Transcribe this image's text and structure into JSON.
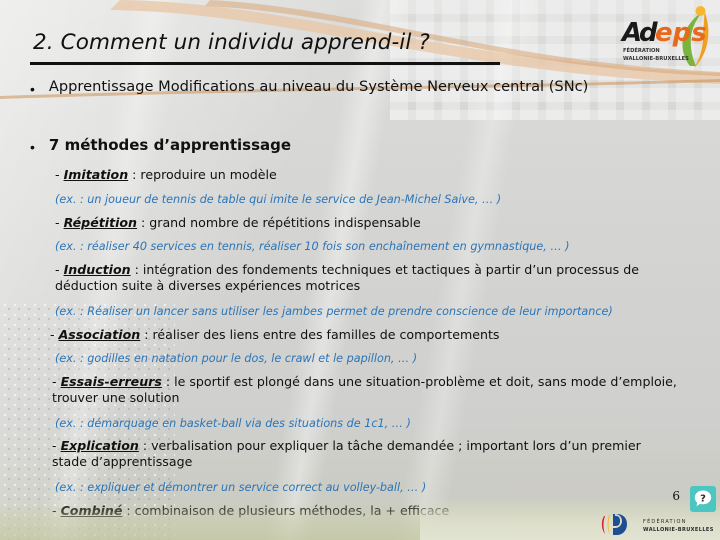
{
  "slide": {
    "title": "2. Comment un individu apprend-il ?",
    "page_number": "6",
    "bullets": [
      {
        "text": "Apprentissage  Modifications au niveau du Système Nerveux central (SNc)",
        "bold": false
      },
      {
        "text": "7 méthodes d’apprentissage",
        "bold": true
      }
    ],
    "methods": [
      {
        "lead": "Imitation",
        "dash": "- ",
        "rest": " : reproduire un modèle",
        "example": "(ex. : un joueur de tennis de table qui imite le service de Jean-Michel Saive, … )"
      },
      {
        "lead": "Répétition",
        "dash": "- ",
        "rest": " : grand nombre de répétitions indispensable",
        "example": "(ex. : réaliser 40 services en tennis, réaliser 10 fois son enchaînement en gymnastique, … )"
      },
      {
        "lead": "Induction",
        "dash": "- ",
        "rest": " : intégration des fondements techniques et tactiques à partir d’un processus de déduction suite à diverses expériences motrices",
        "example": "(ex. : Réaliser un lancer sans utiliser les jambes permet de prendre conscience de leur importance)"
      },
      {
        "lead": "Association",
        "dash": "- ",
        "rest": " : réaliser des liens entre des familles de comportements",
        "example": "(ex. : godilles en natation pour le dos, le crawl et le papillon, … )"
      },
      {
        "lead": "Essais-erreurs",
        "dash": "- ",
        "rest": " : le sportif est plongé dans une situation-problème et doit, sans mode d’emploie, trouver une solution",
        "example": "(ex. : démarquage en basket-ball via des situations de 1c1, … )"
      },
      {
        "lead": "Explication",
        "dash": "- ",
        "rest": " : verbalisation pour expliquer la tâche demandée ; important lors d’un premier stade d’apprentissage",
        "example": "(ex. : expliquer et démontrer un service correct au volley-ball, … )"
      },
      {
        "lead": "Combiné",
        "dash": "- ",
        "rest": " : combinaison de plusieurs méthodes, la + efficace",
        "example": ""
      }
    ],
    "logos": {
      "adeps": {
        "wordmark_a": "A",
        "wordmark_d": "d",
        "wordmark_eps": "eps",
        "sub1": "FÉDÉRATION",
        "sub2": "WALLONIE-BRUXELLES"
      },
      "fwb": {
        "line1": "FÉDÉRATION",
        "line2": "WALLONIE-BRUXELLES"
      }
    },
    "help_icon": "question-mark-speech-bubble",
    "colors": {
      "example_blue": "#2a75b8",
      "adeps_orange": "#e8691c",
      "adeps_green": "#7ab43c",
      "help_teal": "#4cc6c0",
      "fwb_red": "#d8232a",
      "fwb_blue": "#1d4f91"
    }
  }
}
